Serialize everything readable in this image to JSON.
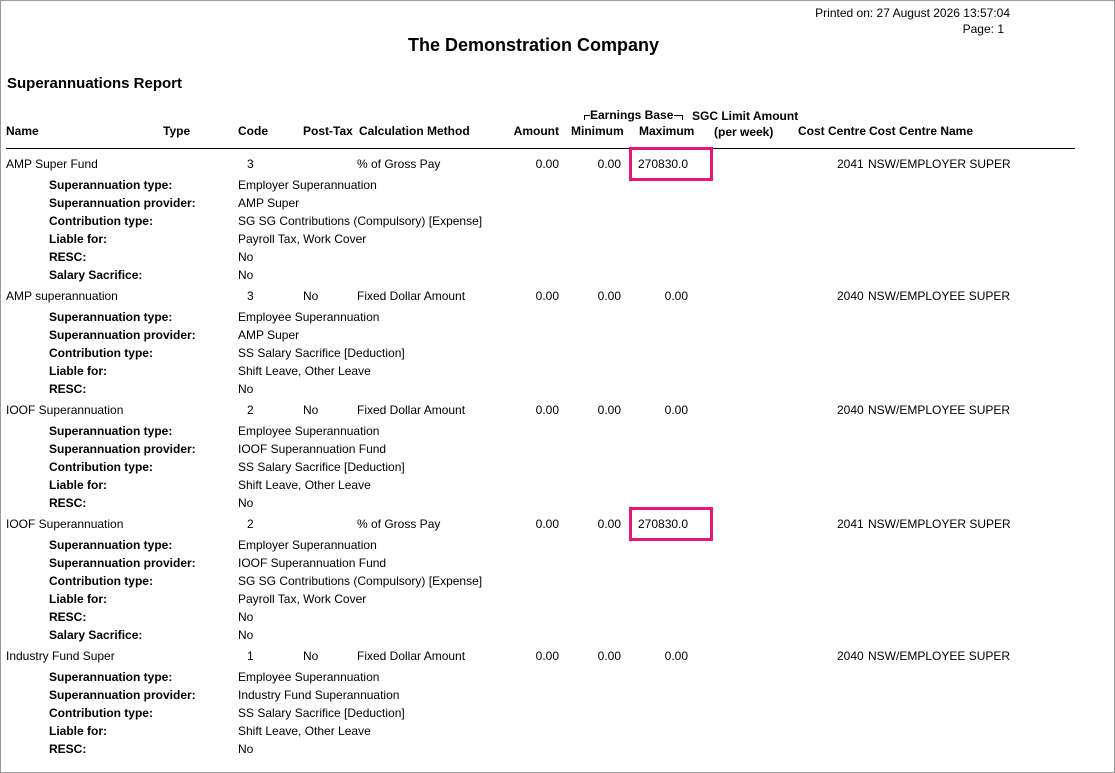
{
  "header": {
    "printed_on": "Printed on: 27 August 2026 13:57:04",
    "page": "Page: 1",
    "company": "The Demonstration Company",
    "report_title": "Superannuations Report"
  },
  "columns": {
    "name": "Name",
    "type": "Type",
    "code": "Code",
    "post_tax": "Post-Tax",
    "calc_method": "Calculation Method",
    "amount": "Amount",
    "earnings_base": "Earnings Base",
    "minimum": "Minimum",
    "maximum": "Maximum",
    "sgc_limit": "SGC Limit Amount",
    "per_week": "(per week)",
    "cost_centre": "Cost Centre",
    "cost_centre_name": "Cost Centre Name"
  },
  "funds": [
    {
      "name": "AMP Super Fund",
      "code": "3",
      "post_tax": "",
      "method": "% of Gross Pay",
      "amount": "0.00",
      "minimum": "0.00",
      "maximum": "270830.0",
      "cost_centre": "2041",
      "cost_centre_name": "NSW/EMPLOYER SUPER",
      "details": [
        {
          "label": "Superannuation type:",
          "value": "Employer Superannuation"
        },
        {
          "label": "Superannuation provider:",
          "value": "AMP Super"
        },
        {
          "label": "Contribution type:",
          "value": "SG SG Contributions (Compulsory) [Expense]"
        },
        {
          "label": "Liable for:",
          "value": "Payroll Tax, Work Cover"
        },
        {
          "label": "RESC:",
          "value": "No"
        },
        {
          "label": "Salary Sacrifice:",
          "value": "No"
        }
      ]
    },
    {
      "name": "AMP superannuation",
      "code": "3",
      "post_tax": "No",
      "method": "Fixed Dollar Amount",
      "amount": "0.00",
      "minimum": "0.00",
      "maximum": "0.00",
      "cost_centre": "2040",
      "cost_centre_name": "NSW/EMPLOYEE SUPER",
      "details": [
        {
          "label": "Superannuation type:",
          "value": "Employee Superannuation"
        },
        {
          "label": "Superannuation provider:",
          "value": "AMP Super"
        },
        {
          "label": "Contribution type:",
          "value": "SS Salary Sacrifice [Deduction]"
        },
        {
          "label": "Liable for:",
          "value": "Shift Leave, Other Leave"
        },
        {
          "label": "RESC:",
          "value": "No"
        }
      ]
    },
    {
      "name": "IOOF Superannuation",
      "code": "2",
      "post_tax": "No",
      "method": "Fixed Dollar Amount",
      "amount": "0.00",
      "minimum": "0.00",
      "maximum": "0.00",
      "cost_centre": "2040",
      "cost_centre_name": "NSW/EMPLOYEE SUPER",
      "details": [
        {
          "label": "Superannuation type:",
          "value": "Employee Superannuation"
        },
        {
          "label": "Superannuation provider:",
          "value": "IOOF Superannuation Fund"
        },
        {
          "label": "Contribution type:",
          "value": "SS Salary Sacrifice [Deduction]"
        },
        {
          "label": "Liable for:",
          "value": "Shift Leave, Other Leave"
        },
        {
          "label": "RESC:",
          "value": "No"
        }
      ]
    },
    {
      "name": "IOOF Superannuation",
      "code": "2",
      "post_tax": "",
      "method": "% of Gross Pay",
      "amount": "0.00",
      "minimum": "0.00",
      "maximum": "270830.0",
      "cost_centre": "2041",
      "cost_centre_name": "NSW/EMPLOYER SUPER",
      "details": [
        {
          "label": "Superannuation type:",
          "value": "Employer Superannuation"
        },
        {
          "label": "Superannuation provider:",
          "value": "IOOF Superannuation Fund"
        },
        {
          "label": "Contribution type:",
          "value": "SG SG Contributions (Compulsory) [Expense]"
        },
        {
          "label": "Liable for:",
          "value": "Payroll Tax, Work Cover"
        },
        {
          "label": "RESC:",
          "value": "No"
        },
        {
          "label": "Salary Sacrifice:",
          "value": "No"
        }
      ]
    },
    {
      "name": "Industry Fund Super",
      "code": "1",
      "post_tax": "No",
      "method": "Fixed Dollar Amount",
      "amount": "0.00",
      "minimum": "0.00",
      "maximum": "0.00",
      "cost_centre": "2040",
      "cost_centre_name": "NSW/EMPLOYEE SUPER",
      "details": [
        {
          "label": "Superannuation type:",
          "value": "Employee Superannuation"
        },
        {
          "label": "Superannuation provider:",
          "value": "Industry Fund Superannuation"
        },
        {
          "label": "Contribution type:",
          "value": "SS Salary Sacrifice [Deduction]"
        },
        {
          "label": "Liable for:",
          "value": "Shift Leave, Other Leave"
        },
        {
          "label": "RESC:",
          "value": "No"
        }
      ]
    }
  ],
  "highlight_color": "#e0197d"
}
